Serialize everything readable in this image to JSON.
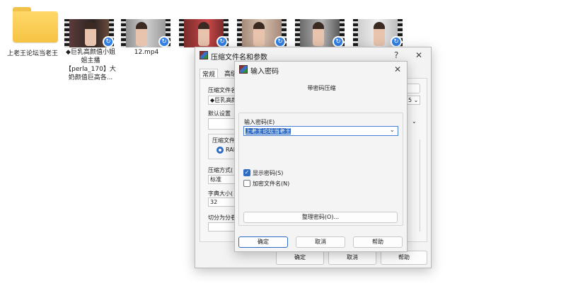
{
  "desktop": {
    "items": [
      {
        "kind": "folder",
        "label": "上老王论坛当老王"
      },
      {
        "kind": "video",
        "label": "◆巨乳高颜值小姐姐主播【perla_170】大奶颜值巨高各..."
      },
      {
        "kind": "video",
        "label": "12.mp4"
      },
      {
        "kind": "video",
        "label": ""
      },
      {
        "kind": "video",
        "label": ""
      },
      {
        "kind": "video",
        "label": ""
      },
      {
        "kind": "video",
        "label": ""
      }
    ]
  },
  "archive_dialog": {
    "title": "压缩文件名和参数",
    "help_glyph": "?",
    "close_glyph": "✕",
    "tabs": [
      "常规",
      "高级"
    ],
    "archive_name_label": "压缩文件名",
    "archive_name_value": "◆巨乳高颜",
    "default_settings_label": "默认设置",
    "format_label": "压缩文件格",
    "format_option": "RAR",
    "method_label": "压缩方式(",
    "method_value": "标准",
    "dict_label": "字典大小(",
    "dict_value": "32",
    "split_label": "切分为分卷",
    "ok_label": "确定",
    "cancel_label": "取消",
    "help_label": "帮助",
    "right_fragment": "5"
  },
  "password_dialog": {
    "title": "输入密码",
    "close_glyph": "✕",
    "heading": "带密码压缩",
    "password_label": "输入密码(E)",
    "password_value": "上老王论坛当老王",
    "show_password_label": "显示密码(S)",
    "show_password_checked": true,
    "encrypt_names_label": "加密文件名(N)",
    "encrypt_names_checked": false,
    "organize_label": "整理密码(O)...",
    "ok_label": "确定",
    "cancel_label": "取消",
    "help_label": "帮助"
  }
}
